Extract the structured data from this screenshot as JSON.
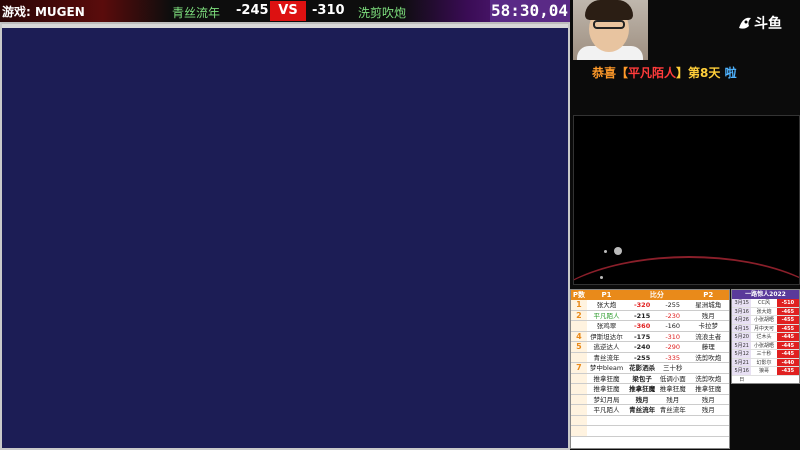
{
  "topbar": {
    "game_label": "游戏: MUGEN",
    "p1_name": "青丝流年",
    "p1_score": "-245",
    "vs": "VS",
    "p2_score": "-310",
    "p2_name": "洗剪吹炮",
    "timer": "58:30,04"
  },
  "brand": {
    "logo_text": "斗鱼"
  },
  "banner": {
    "part1": "恭喜【",
    "part2": "平凡陌人",
    "part3": "】第8天",
    "part4": " 啦"
  },
  "bracket": {
    "headers": [
      "P数",
      "P1",
      "比分",
      "",
      "P2"
    ],
    "rows": [
      {
        "n": "1",
        "p1": "张大炮",
        "s1": "-320",
        "s2": "-255",
        "p2": "星洲城角"
      },
      {
        "n": "2",
        "p1": "平凡陌人",
        "s1": "-215",
        "s2": "-230",
        "p2": "残月"
      },
      {
        "n": "",
        "p1": "张鸡翠",
        "s1": "-360",
        "s2": "-160",
        "p2": "卡拉梦"
      },
      {
        "n": "4",
        "p1": "伊斯坦达尔",
        "s1": "-175",
        "s2": "-310",
        "p2": "流浪主者"
      },
      {
        "n": "5",
        "p1": "逃逆达人",
        "s1": "-240",
        "s2": "-290",
        "p2": "藤理"
      },
      {
        "n": "",
        "p1": "青丝流年",
        "s1": "-255",
        "s2": "-335",
        "p2": "洗剪吹炮"
      },
      {
        "n": "7",
        "p1": "梦中bleam",
        "s1": "花影洒杀",
        "s2": "三十秒",
        "p2": ""
      },
      {
        "n": "",
        "p1": "推拿狂魔",
        "s1": "梁包子",
        "s2": "低调小面",
        "p2": "洗剪吹炮"
      },
      {
        "n": "",
        "p1": "推拿狂魔",
        "s1": "推拿狂魔",
        "s2": "推拿狂魔",
        "p2": "推拿狂魔"
      },
      {
        "n": "",
        "p1": "梦幻月局",
        "s1": "残月",
        "s2": "残月",
        "p2": "残月"
      },
      {
        "n": "",
        "p1": "平凡陌人",
        "s1": "青丝流年",
        "s2": "青丝流年",
        "p2": "残月"
      },
      {
        "n": "",
        "p1": "",
        "s1": "",
        "s2": "",
        "p2": ""
      },
      {
        "n": "",
        "p1": "",
        "s1": "",
        "s2": "",
        "p2": ""
      }
    ]
  },
  "leaderboard": {
    "title": "一路惊人2022",
    "rows": [
      {
        "d": "3月15日",
        "name": "CC风",
        "score": "-510"
      },
      {
        "d": "3月16日",
        "name": "张大炮",
        "score": "-465"
      },
      {
        "d": "4月26日",
        "name": "小张胡晤",
        "score": "-455"
      },
      {
        "d": "4月15日",
        "name": "月中天可",
        "score": "-455"
      },
      {
        "d": "5月20日",
        "name": "烂木头",
        "score": "-445"
      },
      {
        "d": "5月21日",
        "name": "小张胡晤",
        "score": "-445"
      },
      {
        "d": "5月12日",
        "name": "三十秒",
        "score": "-445"
      },
      {
        "d": "5月21日",
        "name": "幻影尔",
        "score": "-440"
      },
      {
        "d": "5月16日",
        "name": "狼哥",
        "score": "-435"
      }
    ]
  },
  "colors": {
    "accent_red": "#e02020",
    "bracket_orange": "#e98a1a",
    "timer_purple": "#5a2a86",
    "game_bg": "#1c1d55"
  }
}
